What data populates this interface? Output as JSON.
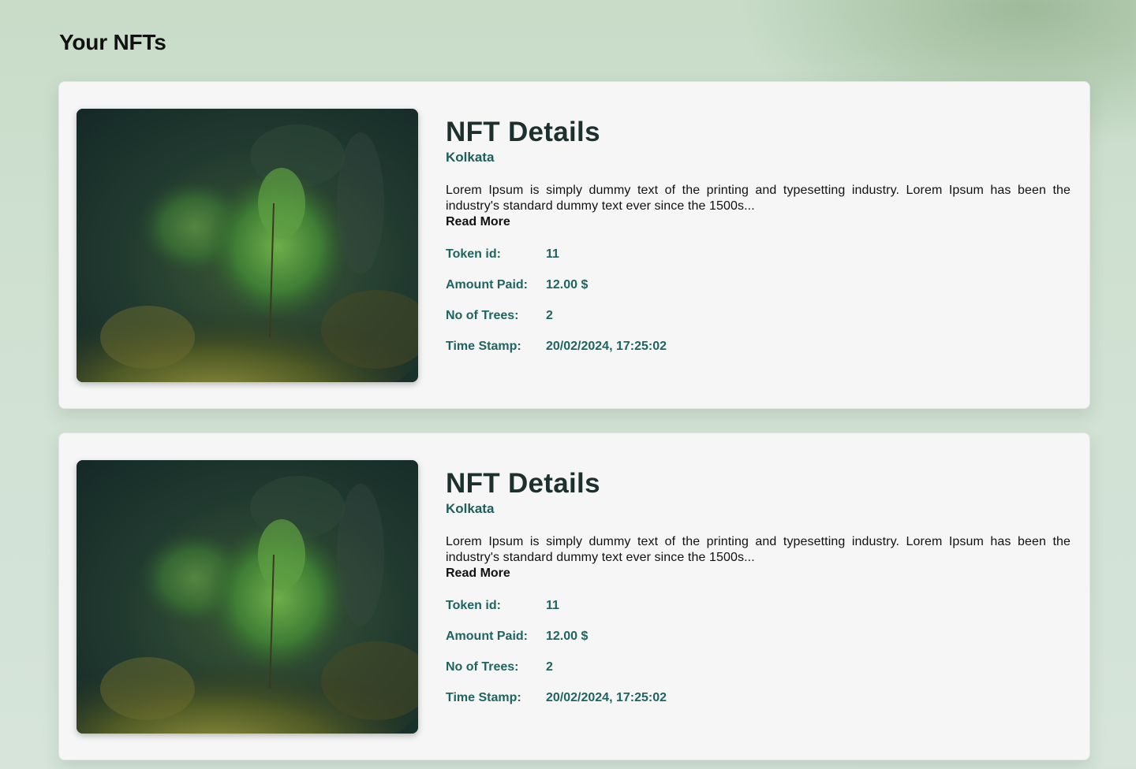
{
  "page": {
    "title": "Your NFTs"
  },
  "nfts": [
    {
      "title": "NFT Details",
      "location": "Kolkata",
      "description": "Lorem Ipsum is simply dummy text of the printing and typesetting industry. Lorem Ipsum has been the industry's standard dummy text ever since the 1500s...",
      "read_more": "Read More",
      "fields": [
        {
          "label": "Token id:",
          "value": "11"
        },
        {
          "label": "Amount Paid:",
          "value": "12.00 $"
        },
        {
          "label": "No of Trees:",
          "value": "2"
        },
        {
          "label": "Time Stamp:",
          "value": "20/02/2024, 17:25:02"
        }
      ],
      "image": "sapling-on-moss-photo"
    },
    {
      "title": "NFT Details",
      "location": "Kolkata",
      "description": "Lorem Ipsum is simply dummy text of the printing and typesetting industry. Lorem Ipsum has been the industry's standard dummy text ever since the 1500s...",
      "read_more": "Read More",
      "fields": [
        {
          "label": "Token id:",
          "value": "11"
        },
        {
          "label": "Amount Paid:",
          "value": "12.00 $"
        },
        {
          "label": "No of Trees:",
          "value": "2"
        },
        {
          "label": "Time Stamp:",
          "value": "20/02/2024, 17:25:02"
        }
      ],
      "image": "sapling-on-moss-photo"
    }
  ],
  "colors": {
    "title": "#1c302d",
    "accent_teal": "#1e6460",
    "card_bg": "#f6f6f6"
  }
}
